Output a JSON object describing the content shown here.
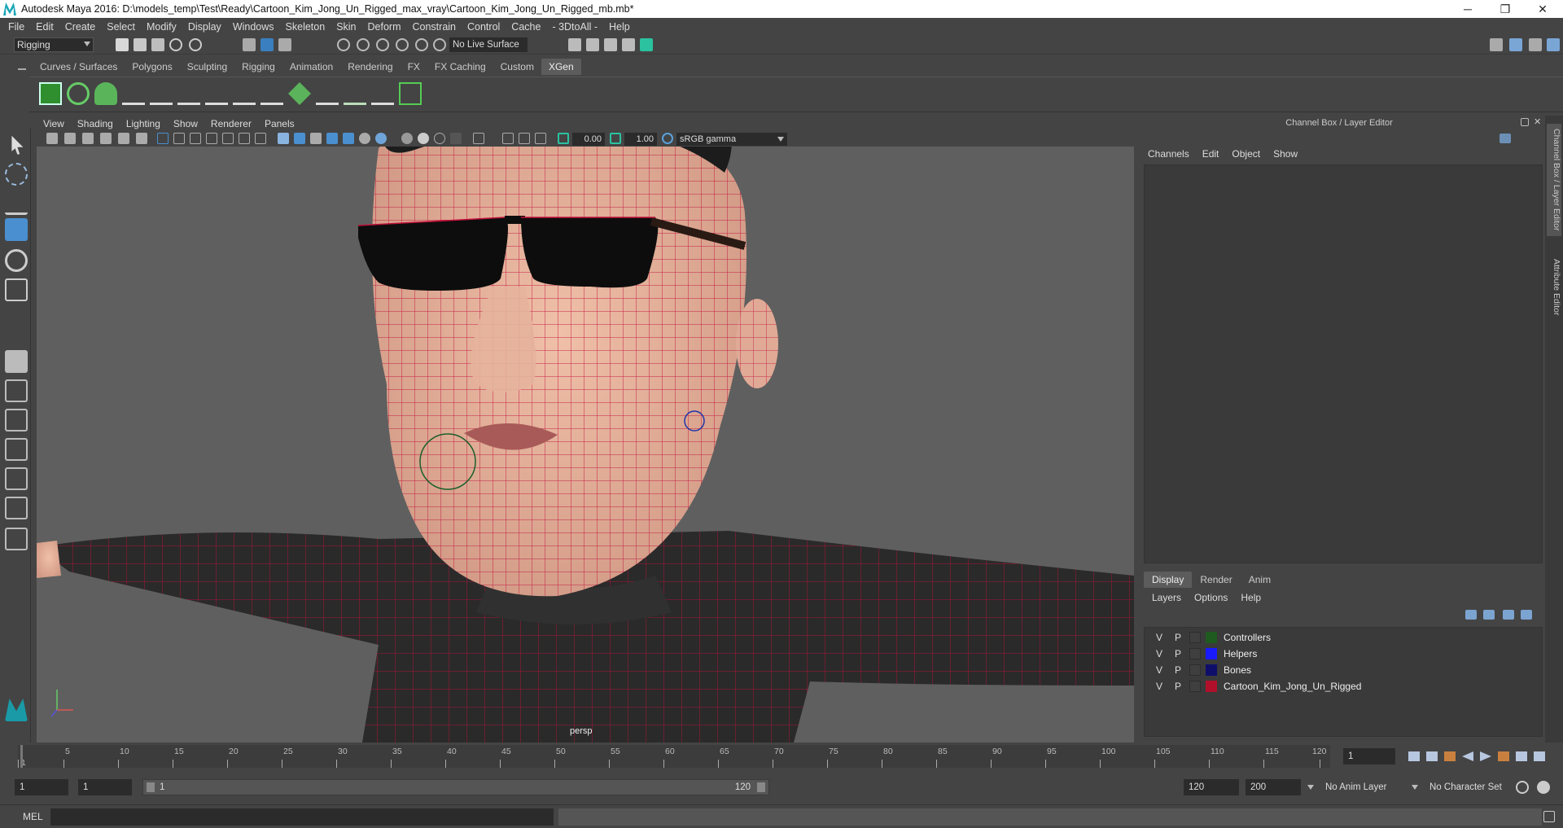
{
  "window": {
    "title": "Autodesk Maya 2016: D:\\models_temp\\Test\\Ready\\Cartoon_Kim_Jong_Un_Rigged_max_vray\\Cartoon_Kim_Jong_Un_Rigged_mb.mb*",
    "controls": [
      "─",
      "❐",
      "✕"
    ]
  },
  "menubar": [
    "File",
    "Edit",
    "Create",
    "Select",
    "Modify",
    "Display",
    "Windows",
    "Skeleton",
    "Skin",
    "Deform",
    "Constrain",
    "Control",
    "Cache",
    "- 3DtoAll -",
    "Help"
  ],
  "statusline": {
    "mode": "Rigging",
    "live_surface": "No Live Surface"
  },
  "shelf": {
    "tabs": [
      "Curves / Surfaces",
      "Polygons",
      "Sculpting",
      "Rigging",
      "Animation",
      "Rendering",
      "FX",
      "FX Caching",
      "Custom",
      "XGen"
    ],
    "active_tab": "XGen"
  },
  "viewport": {
    "menu": [
      "View",
      "Shading",
      "Lighting",
      "Show",
      "Renderer",
      "Panels"
    ],
    "exposure": "0.00",
    "gamma": "1.00",
    "color_space": "sRGB gamma",
    "camera": "persp"
  },
  "channel_box": {
    "title": "Channel Box / Layer Editor",
    "menu": [
      "Channels",
      "Edit",
      "Object",
      "Show"
    ],
    "layer_tabs": [
      "Display",
      "Render",
      "Anim"
    ],
    "active_layer_tab": "Display",
    "layer_menu": [
      "Layers",
      "Options",
      "Help"
    ],
    "layers": [
      {
        "v": "V",
        "p": "P",
        "name": "Controllers",
        "color": "#1f5a1f"
      },
      {
        "v": "V",
        "p": "P",
        "name": "Helpers",
        "color": "#1a1aff"
      },
      {
        "v": "V",
        "p": "P",
        "name": "Bones",
        "color": "#0e0e6a"
      },
      {
        "v": "V",
        "p": "P",
        "name": "Cartoon_Kim_Jong_Un_Rigged",
        "color": "#b0102a"
      }
    ]
  },
  "side_tabs": [
    "Channel Box / Layer Editor",
    "Attribute Editor"
  ],
  "timeline": {
    "ticks": [
      "5",
      "10",
      "15",
      "20",
      "25",
      "30",
      "35",
      "40",
      "45",
      "50",
      "55",
      "60",
      "65",
      "70",
      "75",
      "80",
      "85",
      "90",
      "95",
      "100",
      "105",
      "110",
      "115",
      "120"
    ],
    "start_marker": "1",
    "current_frame": "1"
  },
  "range": {
    "start": "1",
    "playback_start": "1",
    "slider_start": "1",
    "slider_end": "120",
    "playback_end": "120",
    "end": "200",
    "anim_layer": "No Anim Layer",
    "character_set": "No Character Set"
  },
  "command_line": {
    "label": "MEL"
  },
  "colors": {
    "accent": "#00a0b0",
    "wire": "#c0103a"
  }
}
